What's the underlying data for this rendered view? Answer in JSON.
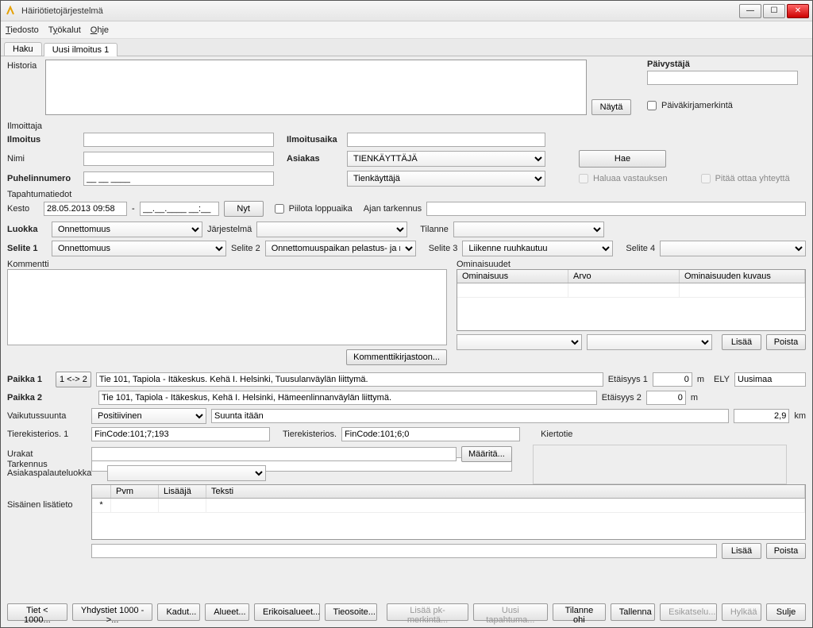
{
  "window": {
    "title": "Häiriötietojärjestelmä"
  },
  "menu": {
    "tiedosto": "Tiedosto",
    "tyokalut": "Työkalut",
    "ohje": "Ohje"
  },
  "tabs": {
    "haku": "Haku",
    "uusi": "Uusi ilmoitus 1"
  },
  "historia": {
    "label": "Historia",
    "nayta": "Näytä"
  },
  "paivystaja": {
    "label": "Päivystäjä",
    "merkinta": "Päiväkirjamerkintä"
  },
  "ilmoittaja": {
    "hdr": "Ilmoittaja",
    "ilmoitus": "Ilmoitus",
    "nimi": "Nimi",
    "puh": "Puhelinnumero",
    "puh_mask": "__ __ ____",
    "ilmoitusaika": "Ilmoitusaika",
    "asiakas": "Asiakas",
    "asiakas_val": "TIENKÄYTTÄJÄ",
    "asiakas_sub": "Tienkäyttäjä",
    "hae": "Hae",
    "haluaa": "Haluaa vastauksen",
    "pitaa": "Pitää ottaa yhteyttä"
  },
  "tapahtuma": {
    "hdr": "Tapahtumatiedot",
    "kesto": "Kesto",
    "kesto_from": "28.05.2013 09:58",
    "kesto_sep": "-",
    "kesto_to": "__.__.____ __:__",
    "nyt": "Nyt",
    "piilota": "Piilota loppuaika",
    "ajan": "Ajan tarkennus"
  },
  "luokka": {
    "luokka": "Luokka",
    "luokka_val": "Onnettomuus",
    "jarj": "Järjestelmä",
    "tilanne": "Tilanne",
    "s1": "Selite 1",
    "s1_val": "Onnettomuus",
    "s2": "Selite 2",
    "s2_val": "Onnettomuuspaikan pelastus- ja raivaust",
    "s3": "Selite 3",
    "s3_val": "Liikenne ruuhkautuu",
    "s4": "Selite 4"
  },
  "kommentti": {
    "label": "Kommentti",
    "btn": "Kommenttikirjastoon..."
  },
  "ominaisuudet": {
    "label": "Ominaisuudet",
    "c1": "Ominaisuus",
    "c2": "Arvo",
    "c3": "Ominaisuuden kuvaus",
    "lisaa": "Lisää",
    "poista": "Poista"
  },
  "paikka": {
    "p1": "Paikka 1",
    "p2": "Paikka 2",
    "swap": "1 <-> 2",
    "p1_val": "Tie 101, Tapiola - Itäkeskus. Kehä I. Helsinki, Tuusulanväylän liittymä.",
    "p2_val": "Tie 101, Tapiola - Itäkeskus, Kehä I. Helsinki, Hämeenlinnanväylän liittymä.",
    "et1": "Etäisyys 1",
    "et1_v": "0",
    "m": "m",
    "et2": "Etäisyys 2",
    "et2_v": "0",
    "ely": "ELY",
    "ely_v": "Uusimaa"
  },
  "vaikutus": {
    "label": "Vaikutussuunta",
    "val": "Positiivinen",
    "suunta_lbl": "Suunta itään",
    "dist": "2,9",
    "km": "km"
  },
  "tiere": {
    "l1": "Tierekisterios. 1",
    "v1": "FinCode:101;7;193",
    "l2": "Tierekisterios.",
    "v2": "FinCode:101;6;0",
    "kierto": "Kiertotie"
  },
  "tarkennus": "Tarkennus",
  "urakat": {
    "label": "Urakat",
    "maarita": "Määritä..."
  },
  "apl": "Asiakaspalauteluokka",
  "sisainen": {
    "label": "Sisäinen lisätieto",
    "c1": "Pvm",
    "c2": "Lisääjä",
    "c3": "Teksti",
    "star": "*",
    "lisaa": "Lisää",
    "poista": "Poista"
  },
  "footer": {
    "tiet": "Tiet < 1000...",
    "yhdys": "Yhdystiet 1000 ->...",
    "kadut": "Kadut...",
    "alueet": "Alueet...",
    "erik": "Erikoisalueet...",
    "tieo": "Tieosoite...",
    "lisaa_pk": "Lisää pk-merkintä...",
    "uusi": "Uusi tapahtuma...",
    "tilanne": "Tilanne ohi",
    "tallenna": "Tallenna",
    "esik": "Esikatselu...",
    "hylkaa": "Hylkää",
    "sulje": "Sulje"
  }
}
